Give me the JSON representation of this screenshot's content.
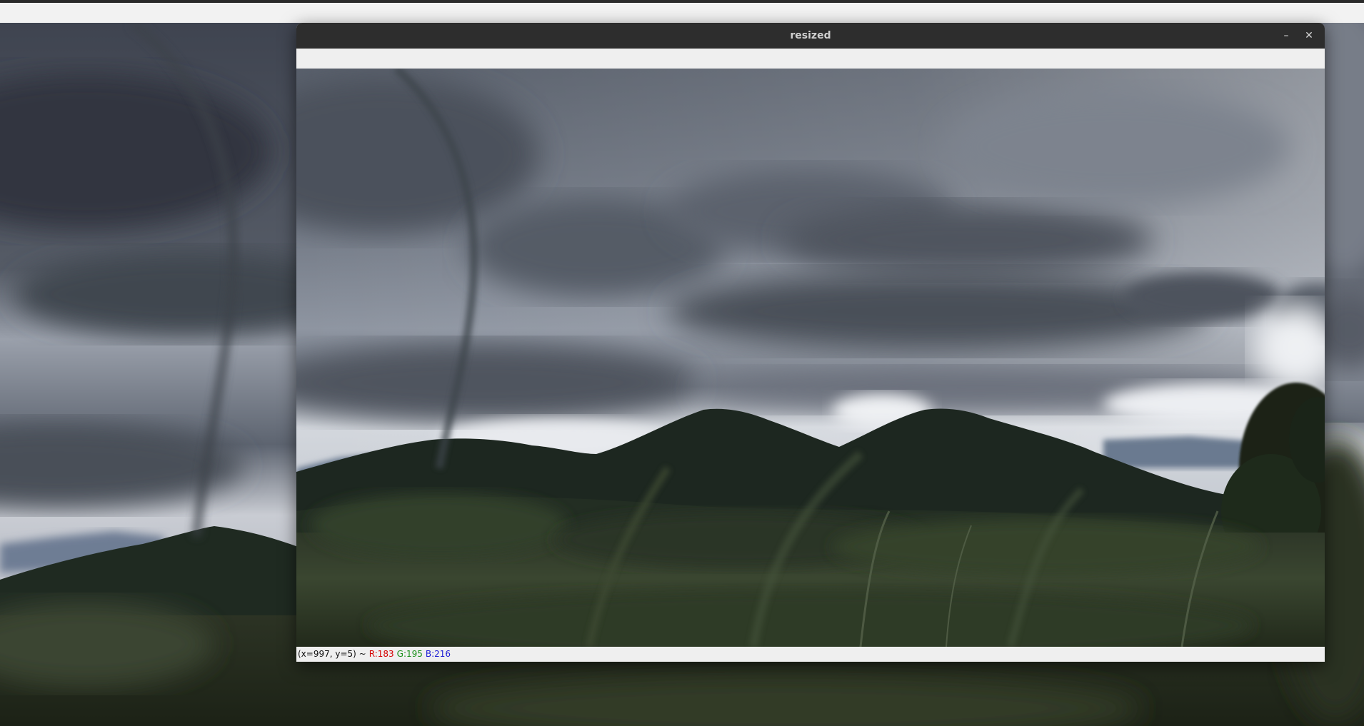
{
  "window": {
    "title": "resized",
    "minimize_label": "–",
    "close_label": "✕"
  },
  "status": {
    "coords": "(x=997, y=5) ~",
    "r": "R:183",
    "g": "G:195",
    "b": "B:216"
  },
  "icons": {
    "minimize": "minimize-icon",
    "close": "close-icon"
  }
}
